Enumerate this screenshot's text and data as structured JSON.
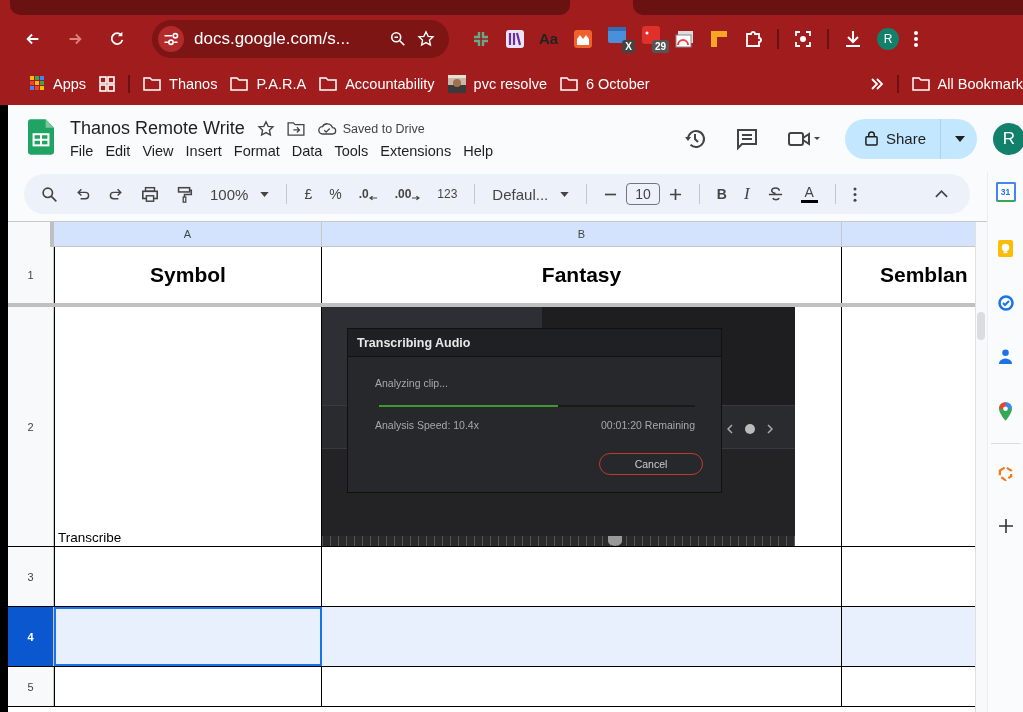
{
  "browser": {
    "address": "docs.google.com/s...",
    "ext_font_label": "Aa",
    "ext_badge_x": "X",
    "ext_badge_count": "29",
    "profile_initial": "R",
    "bookmarks": [
      {
        "kind": "apps",
        "label": "Apps"
      },
      {
        "kind": "grid"
      },
      {
        "kind": "folder",
        "label": "Thanos"
      },
      {
        "kind": "folder",
        "label": "P.A.R.A"
      },
      {
        "kind": "folder",
        "label": "Accountability"
      },
      {
        "label": "pvc resolve"
      },
      {
        "kind": "folder",
        "label": "6 October"
      }
    ],
    "all_bookmarks": "All Bookmark"
  },
  "sheets": {
    "title": "Thanos Remote Write",
    "saved": "Saved to Drive",
    "menus": [
      "File",
      "Edit",
      "View",
      "Insert",
      "Format",
      "Data",
      "Tools",
      "Extensions",
      "Help"
    ],
    "share": "Share",
    "avatar": "R"
  },
  "toolbar": {
    "zoom": "100%",
    "currency": "£",
    "percent": "%",
    "decrease_decimals": ".0",
    "increase_decimals": ".00",
    "number_format": "123",
    "font": "Defaul...",
    "font_size": "10",
    "bold": "B",
    "italic": "I",
    "text_color": "A"
  },
  "grid": {
    "columns": [
      {
        "label": "A",
        "selected": false
      },
      {
        "label": "B",
        "selected": false
      },
      {
        "selected": false
      }
    ],
    "rows": [
      {
        "number": "1",
        "selected": false,
        "kind": "header",
        "cells": [
          "Symbol",
          "Fantasy",
          "Semblan"
        ]
      },
      {
        "number": "2",
        "selected": false,
        "kind": "media",
        "cells": [
          "Transcribe"
        ]
      },
      {
        "number": "3",
        "selected": false,
        "kind": "plain",
        "cells": []
      },
      {
        "number": "4",
        "selected": true,
        "kind": "plain",
        "cells": []
      },
      {
        "number": "5",
        "selected": false,
        "kind": "plain",
        "cells": []
      }
    ]
  },
  "embedded": {
    "dialog_title": "Transcribing Audio",
    "status": "Analyzing clip...",
    "level": 0.565,
    "speed": "Analysis Speed: 10.4x",
    "remaining": "00:01:20 Remaining",
    "button": "Cancel"
  },
  "side_panel": {
    "calendar_day": "31"
  }
}
